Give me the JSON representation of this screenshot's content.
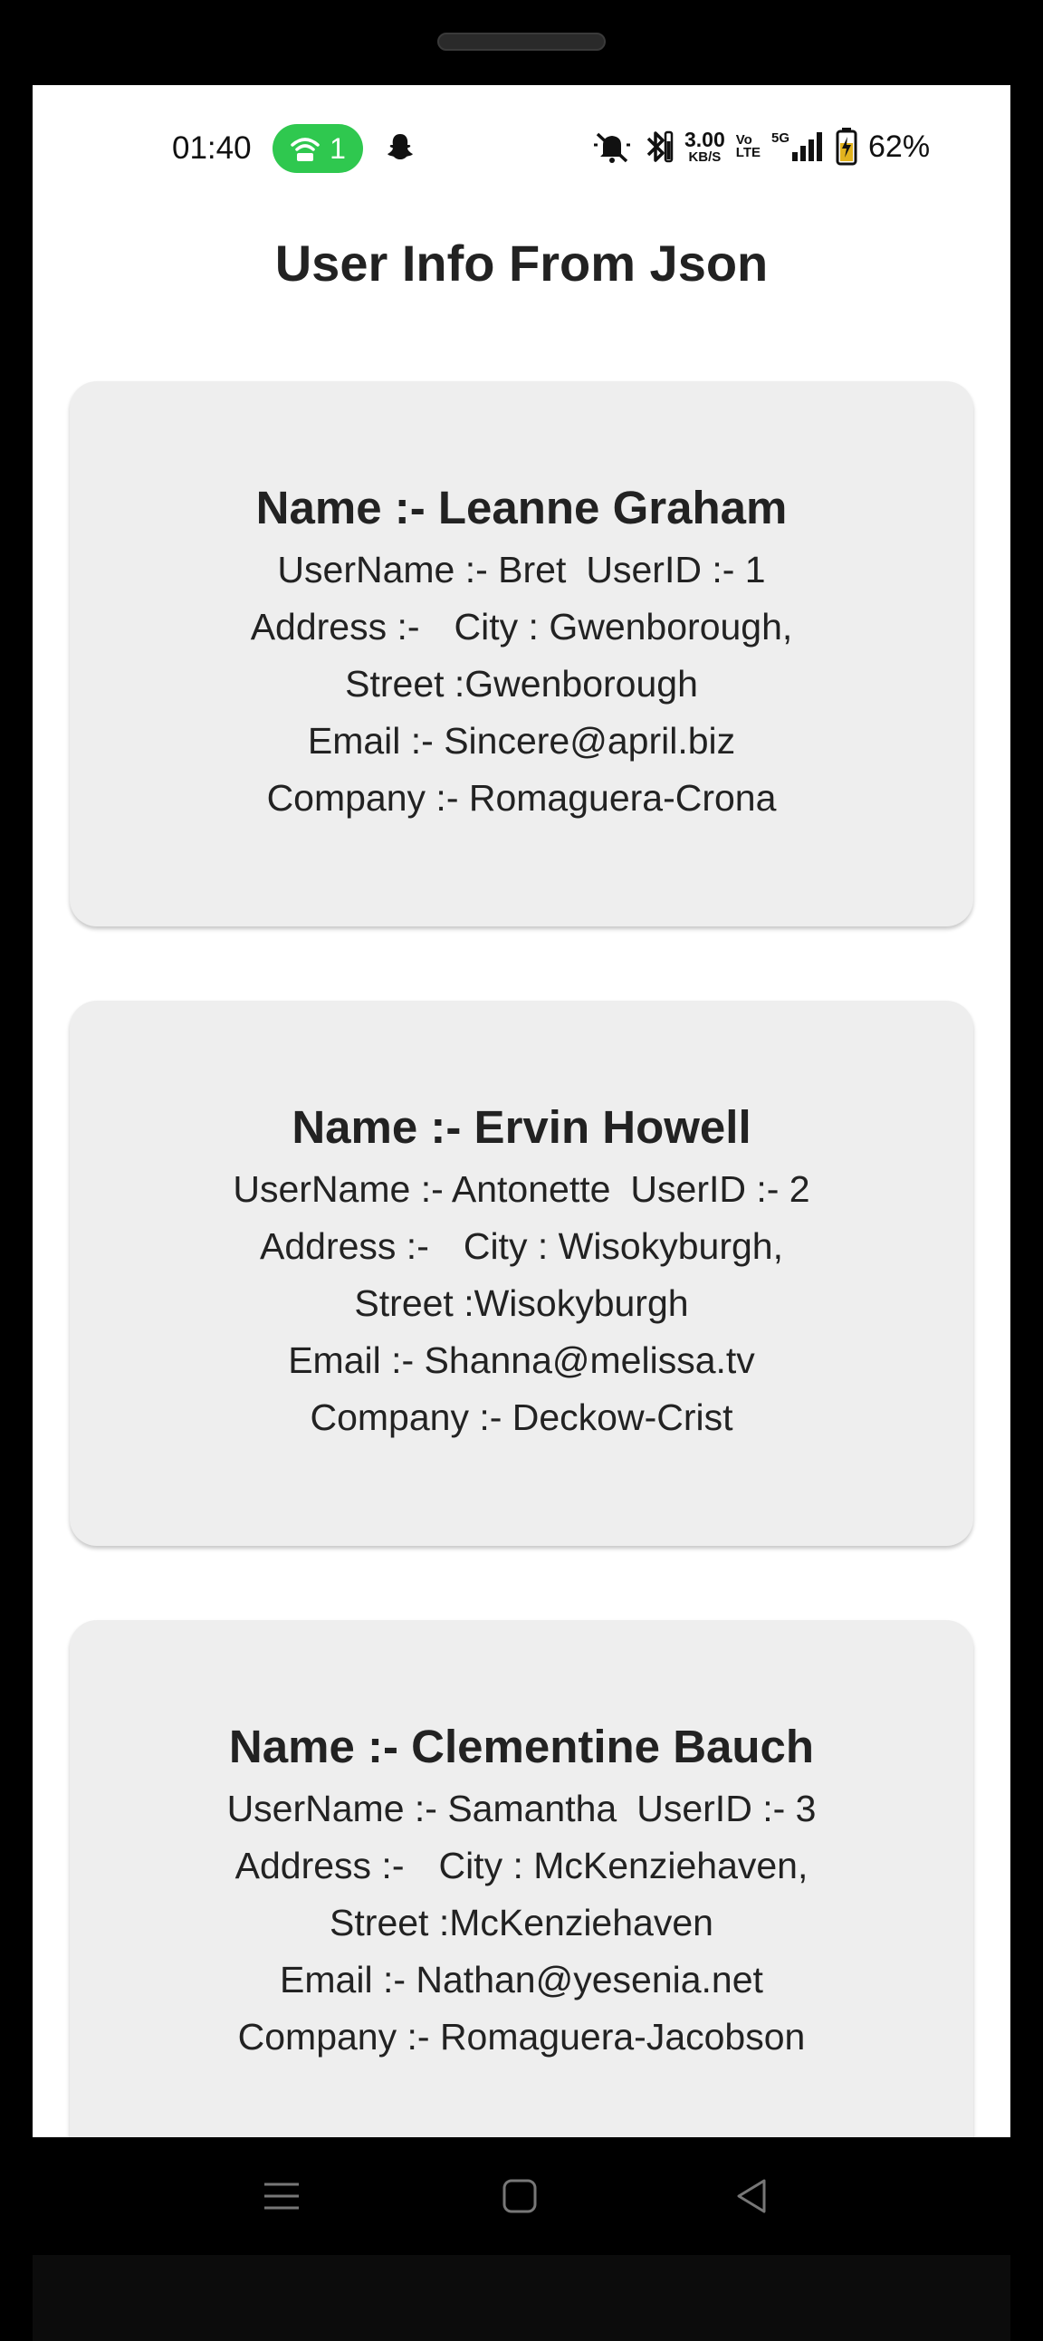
{
  "status_bar": {
    "time": "01:40",
    "hotspot_count": "1",
    "net_speed_value": "3.00",
    "net_speed_unit": "KB/S",
    "volte_top": "Vo",
    "volte_bottom": "LTE",
    "network_type": "5G",
    "battery_percent": "62%"
  },
  "page": {
    "title": "User Info From Json"
  },
  "users": [
    {
      "name": "Name :- Leanne Graham",
      "username": "UserName :- Bret",
      "userid": "UserID :- 1",
      "address_label": "Address :-",
      "city": "City : Gwenborough,",
      "street": "Street :Gwenborough",
      "email": "Email :- Sincere@april.biz",
      "company": "Company :- Romaguera-Crona"
    },
    {
      "name": "Name :- Ervin Howell",
      "username": "UserName :- Antonette",
      "userid": "UserID :- 2",
      "address_label": "Address :-",
      "city": "City : Wisokyburgh,",
      "street": "Street :Wisokyburgh",
      "email": "Email :- Shanna@melissa.tv",
      "company": "Company :- Deckow-Crist"
    },
    {
      "name": "Name :- Clementine Bauch",
      "username": "UserName :- Samantha",
      "userid": "UserID :- 3",
      "address_label": "Address :-",
      "city": "City : McKenziehaven,",
      "street": "Street :McKenziehaven",
      "email": "Email :- Nathan@yesenia.net",
      "company": "Company :- Romaguera-Jacobson"
    }
  ],
  "icons": {
    "hotspot": "hotspot-icon",
    "snapchat": "snapchat-icon",
    "mute": "mute-icon",
    "bluetooth": "bluetooth-icon",
    "signal": "signal-icon",
    "battery": "battery-charging-icon",
    "menu": "menu-icon",
    "home": "home-icon",
    "back": "back-icon"
  },
  "colors": {
    "hotspot_pill": "#2fc84f",
    "card_bg": "#eeeeee",
    "text": "#222222"
  }
}
